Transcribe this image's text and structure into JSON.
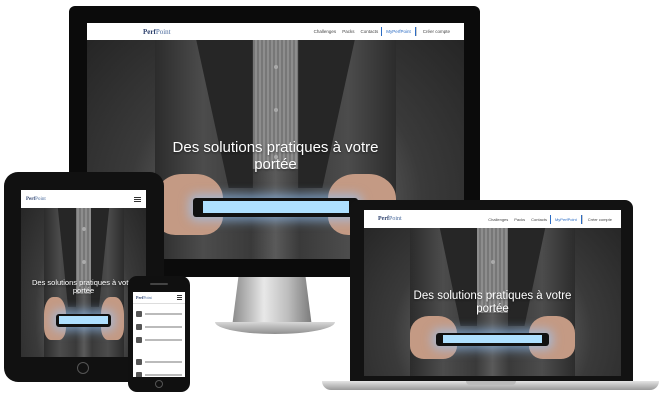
{
  "site": {
    "logo_bold": "Perf",
    "logo_light": "Point",
    "nav": [
      "Challenges",
      "Packs",
      "Contacts",
      "MyPerfPoint",
      "Créer compte"
    ],
    "headline": "Des solutions pratiques à votre portée"
  },
  "colors": {
    "brand": "#2b3f6b",
    "active_link": "#2b6cc4",
    "device_bezel": "#111111"
  },
  "icons": {
    "menu": "hamburger-icon"
  }
}
